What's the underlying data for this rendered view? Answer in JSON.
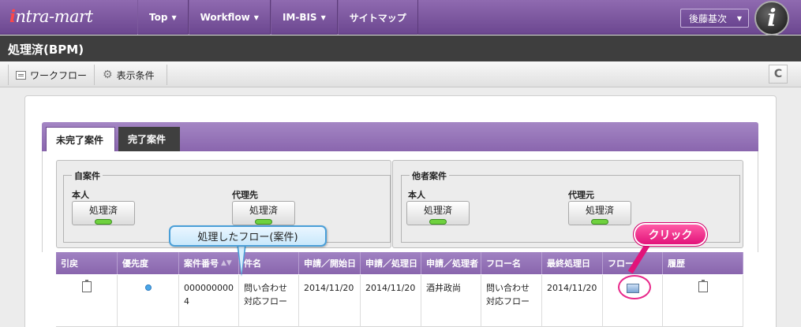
{
  "header": {
    "logo_i": "i",
    "logo_rest": "ntra-mart",
    "nav": [
      {
        "label": "Top",
        "caret": "▼"
      },
      {
        "label": "Workflow",
        "caret": "▼"
      },
      {
        "label": "IM-BIS",
        "caret": "▼"
      },
      {
        "label": "サイトマップ",
        "caret": ""
      }
    ],
    "user_name": "後藤基次",
    "user_caret": "▼",
    "user_icon_glyph": "i"
  },
  "page": {
    "title": "処理済(BPM)"
  },
  "toolbar": {
    "workflow_label": "ワークフロー",
    "conditions_label": "表示条件",
    "refresh_glyph": "C"
  },
  "tabs": {
    "active_label": "未完了案件",
    "inactive_label": "完了案件"
  },
  "filters": {
    "own": {
      "legend": "自案件",
      "self_label": "本人",
      "self_button": "処理済",
      "proxy_label": "代理先",
      "proxy_button": "処理済"
    },
    "others": {
      "legend": "他者案件",
      "self_label": "本人",
      "self_button": "処理済",
      "proxy_label": "代理元",
      "proxy_button": "処理済"
    }
  },
  "table": {
    "headers": [
      "引戻",
      "優先度",
      "案件番号",
      "件名",
      "申請／開始日",
      "申請／処理日",
      "申請／処理者",
      "フロー名",
      "最終処理日",
      "フロー",
      "履歴"
    ],
    "sort_glyph": "▲▼",
    "row": {
      "case_number": "0000000004",
      "subject": "問い合わせ対応フロー",
      "start_date": "2014/11/20",
      "process_date": "2014/11/20",
      "processor": "酒井政尚",
      "flow_name": "問い合わせ対応フロー",
      "last_date": "2014/11/20"
    }
  },
  "annotations": {
    "blue_callout": "処理したフロー(案件)",
    "pink_callout": "クリック"
  },
  "colors": {
    "brand_purple": "#7b56a0",
    "callout_pink": "#e2137a",
    "callout_blue": "#4a9fd8"
  }
}
